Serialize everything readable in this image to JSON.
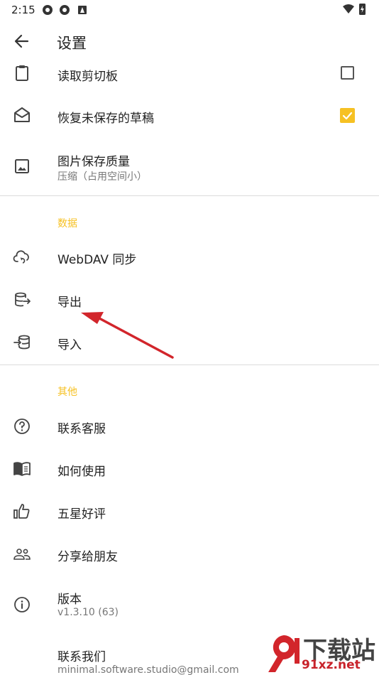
{
  "status_bar": {
    "time": "2:15"
  },
  "app_bar": {
    "title": "设置"
  },
  "colors": {
    "accent": "#f6c123",
    "arrow": "#d2252b"
  },
  "general_items": [
    {
      "title": "读取剪切板",
      "icon": "clipboard-icon",
      "checked": false
    },
    {
      "title": "恢复未保存的草稿",
      "icon": "mail-open-icon",
      "checked": true
    },
    {
      "title": "图片保存质量",
      "subtitle": "压缩（占用空间小）",
      "icon": "image-icon"
    }
  ],
  "data_section": {
    "header": "数据",
    "items": [
      {
        "title": "WebDAV 同步",
        "icon": "cloud-sync-icon"
      },
      {
        "title": "导出",
        "icon": "database-export-icon"
      },
      {
        "title": "导入",
        "icon": "database-import-icon"
      }
    ]
  },
  "other_section": {
    "header": "其他",
    "items": [
      {
        "title": "联系客服",
        "icon": "help-circle-icon"
      },
      {
        "title": "如何使用",
        "icon": "book-open-icon"
      },
      {
        "title": "五星好评",
        "icon": "thumb-up-icon"
      },
      {
        "title": "分享给朋友",
        "icon": "people-icon"
      },
      {
        "title": "版本",
        "subtitle": "v1.3.10 (63)",
        "icon": "info-icon"
      },
      {
        "title": "联系我们",
        "subtitle": "minimal.software.studio@gmail.com"
      }
    ]
  },
  "watermark": {
    "big": "下载站",
    "small": "91xz.net"
  }
}
